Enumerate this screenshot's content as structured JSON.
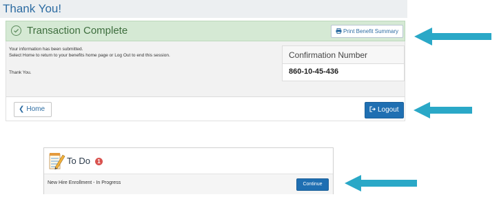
{
  "page": {
    "title": "Thank You!"
  },
  "transaction": {
    "title": "Transaction Complete",
    "print_label": "Print Benefit Summary",
    "messages": [
      "Your information has been submitted.",
      "Select Home to return to your benefits home page or Log Out to end this session.",
      "Thank You."
    ],
    "confirmation_label": "Confirmation Number",
    "confirmation_number": "860-10-45-436"
  },
  "footer": {
    "home_label": "Home",
    "logout_label": "Logout"
  },
  "todo": {
    "title": "To Do",
    "badge_count": "1",
    "item_label": "New Hire Enrollment - In Progress",
    "continue_label": "Continue"
  },
  "colors": {
    "title_bar": "#eceff1",
    "success_header": "#d5e9d4",
    "primary_button": "#1f6fb2",
    "badge": "#d9534f",
    "pointer_arrow": "#2aa8c7"
  },
  "icons": {
    "transaction": "check-circle-icon",
    "print": "printer-icon",
    "home": "chevron-left-icon",
    "logout": "logout-icon",
    "todo": "notepad-icon"
  }
}
